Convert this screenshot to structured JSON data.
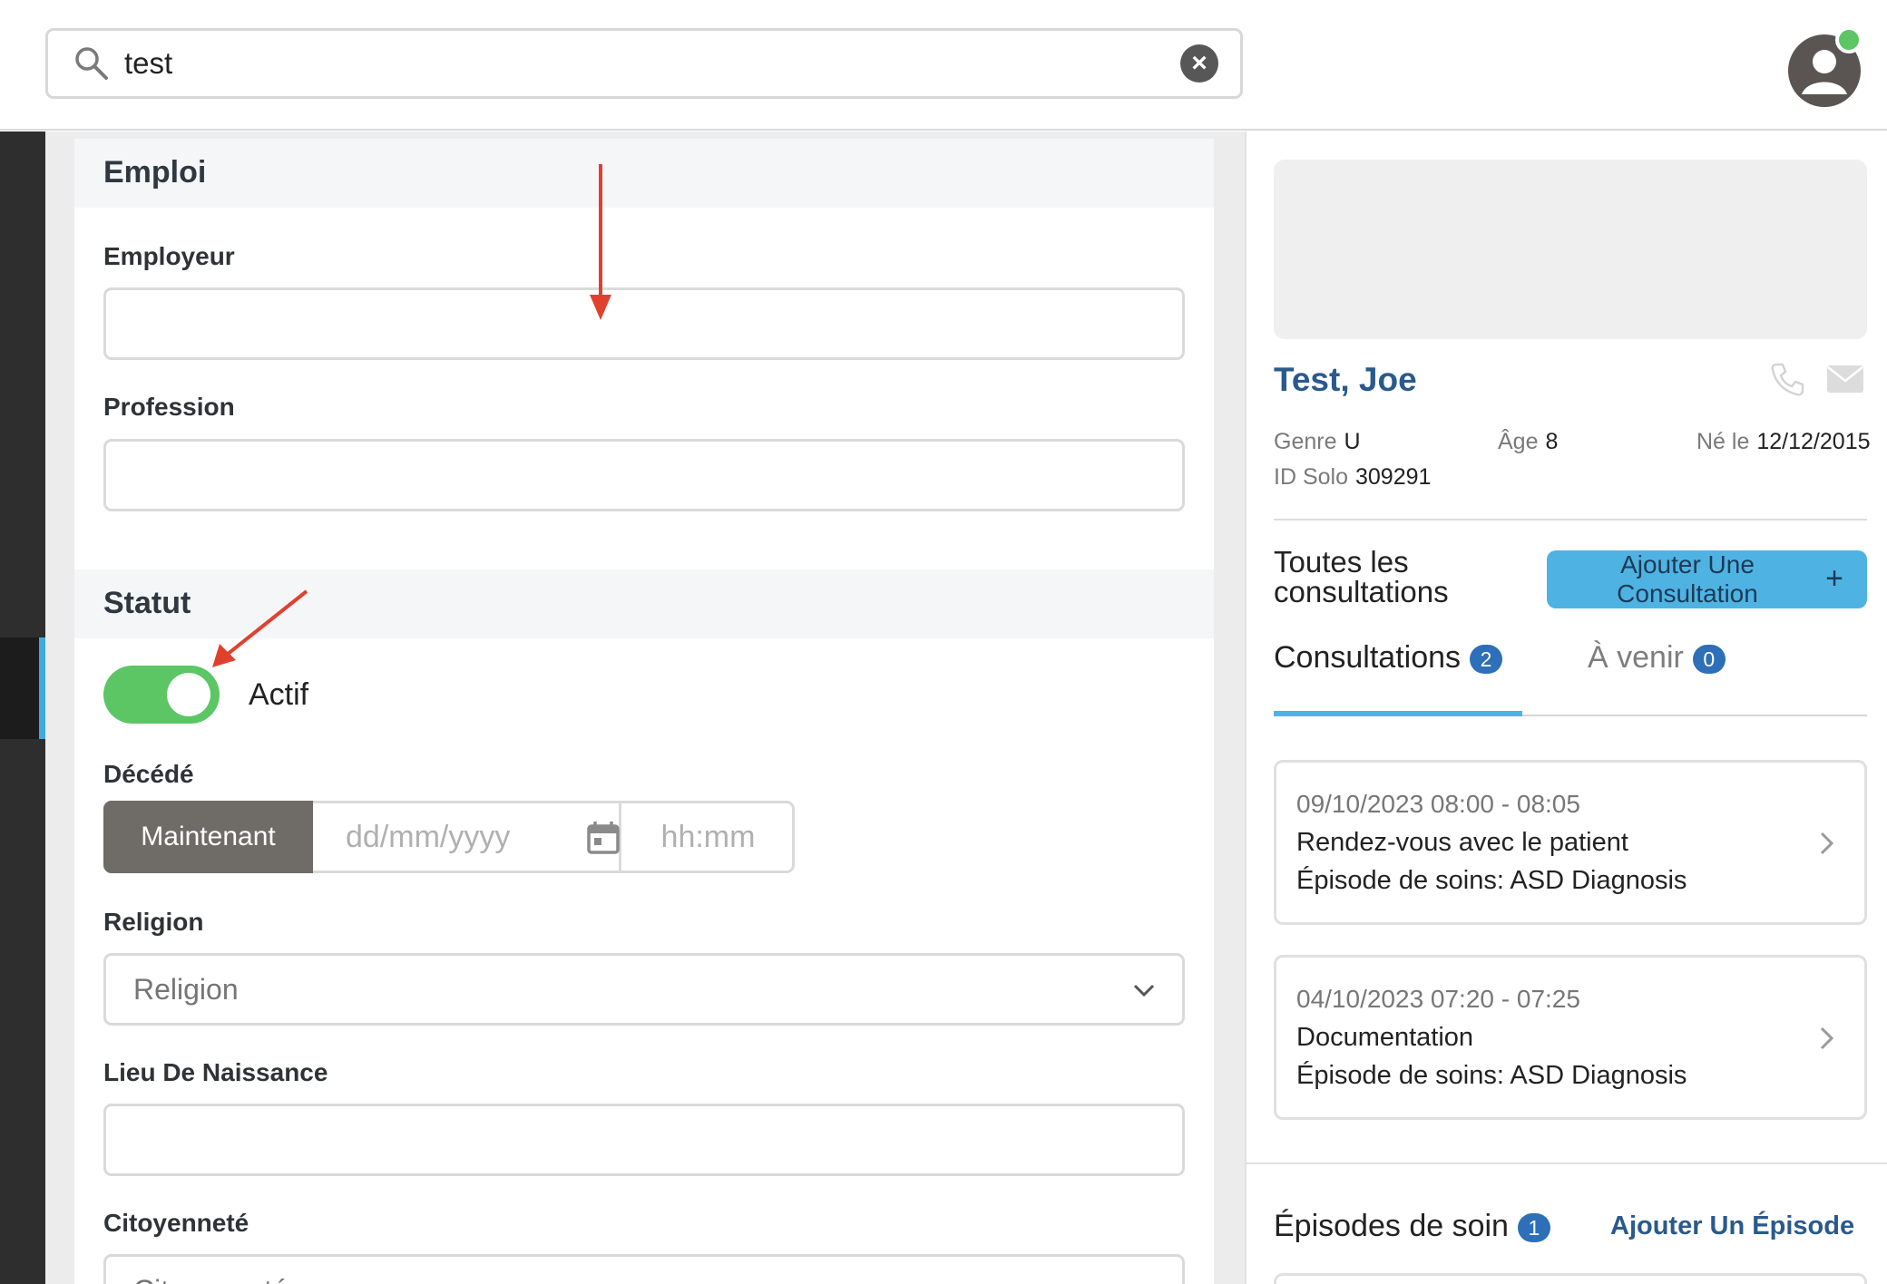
{
  "search": {
    "value": "test"
  },
  "form": {
    "emploi": {
      "heading": "Emploi",
      "employer_label": "Employeur",
      "employer_value": "",
      "profession_label": "Profession",
      "profession_value": ""
    },
    "statut": {
      "heading": "Statut",
      "active_label": "Actif",
      "active_on": true,
      "deceased_label": "Décédé",
      "now_button": "Maintenant",
      "date_placeholder": "dd/mm/yyyy",
      "time_placeholder": "hh:mm",
      "religion_label": "Religion",
      "religion_placeholder": "Religion",
      "birthplace_label": "Lieu De Naissance",
      "birthplace_value": "",
      "citizenship_label": "Citoyenneté",
      "citizenship_placeholder": "Citoyenneté"
    }
  },
  "patient": {
    "name": "Test, Joe",
    "genre_label": "Genre",
    "genre_value": "U",
    "age_label": "Âge",
    "age_value": "8",
    "born_label": "Né le",
    "born_value": "12/12/2015",
    "id_label": "ID Solo",
    "id_value": "309291"
  },
  "consultations": {
    "all_label_line1": "Toutes les",
    "all_label_line2": "consultations",
    "add_line1": "Ajouter Une",
    "add_line2": "Consultation",
    "add_plus": "+",
    "tabs": [
      {
        "label": "Consultations",
        "count": "2"
      },
      {
        "label": "À venir",
        "count": "0"
      }
    ],
    "items": [
      {
        "when": "09/10/2023 08:00 - 08:05",
        "title": "Rendez-vous avec le patient",
        "episode": "Épisode de soins: ASD Diagnosis"
      },
      {
        "when": "04/10/2023 07:20 - 07:25",
        "title": "Documentation",
        "episode": "Épisode de soins: ASD Diagnosis"
      }
    ]
  },
  "episodes": {
    "label": "Épisodes de soin",
    "count": "1",
    "add_label": "Ajouter Un Épisode"
  },
  "colors": {
    "accent_blue": "#4eb3e3",
    "name_blue": "#2a5a8c",
    "toggle_green": "#5cc665",
    "badge_blue": "#2d6fb8",
    "annotation_red": "#e0412f"
  }
}
